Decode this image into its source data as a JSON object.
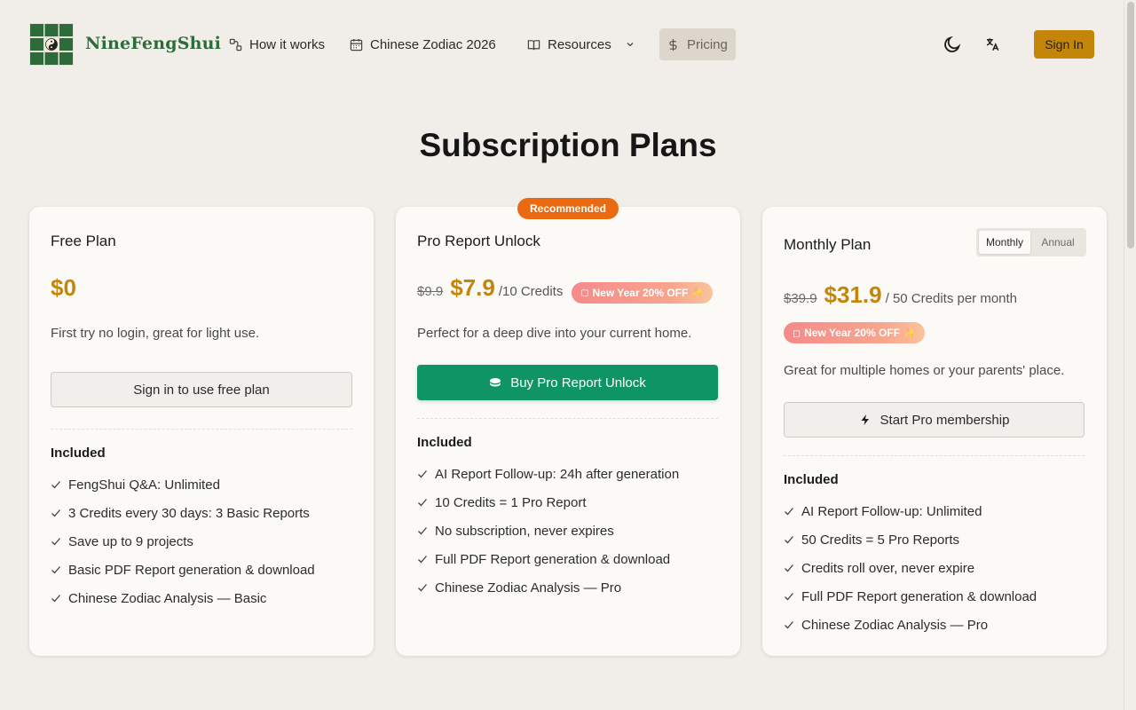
{
  "header": {
    "brand": "NineFengShui",
    "nav": [
      {
        "label": "How it works",
        "icon": "route-icon"
      },
      {
        "label": "Chinese Zodiac 2026",
        "icon": "calendar-icon"
      },
      {
        "label": "Resources",
        "icon": "book-icon"
      },
      {
        "label": "Pricing",
        "icon": "dollar-icon"
      }
    ],
    "signin_label": "Sign In"
  },
  "page_title": "Subscription Plans",
  "colors": {
    "accent": "#c4860a",
    "green": "#0f9565",
    "recommended": "#ea6a11",
    "background": "#f1eeea"
  },
  "plans": {
    "free": {
      "title": "Free Plan",
      "price": "$0",
      "description": "First try no login, great for light use.",
      "button": "Sign in to use free plan",
      "included_label": "Included",
      "features": [
        "FengShui Q&A: Unlimited",
        "3 Credits every 30 days: 3 Basic Reports",
        "Save up to 9 projects",
        "Basic PDF Report generation & download",
        "Chinese Zodiac Analysis — Basic"
      ]
    },
    "pro": {
      "badge": "Recommended",
      "title": "Pro Report Unlock",
      "old_price": "$9.9",
      "price": "$7.9",
      "unit": "/10 Credits",
      "promo": "New Year 20% OFF",
      "description": "Perfect for a deep dive into your current home.",
      "button": "Buy Pro Report Unlock",
      "included_label": "Included",
      "features": [
        "AI Report Follow-up: 24h after generation",
        "10 Credits = 1 Pro Report",
        "No subscription, never expires",
        "Full PDF Report generation & download",
        "Chinese Zodiac Analysis — Pro"
      ]
    },
    "monthly": {
      "title": "Monthly Plan",
      "toggle": [
        "Monthly",
        "Annual"
      ],
      "old_price": "$39.9",
      "price": "$31.9",
      "unit": "/ 50 Credits per month",
      "promo": "New Year 20% OFF",
      "description": "Great for multiple homes or your parents' place.",
      "button": "Start Pro membership",
      "included_label": "Included",
      "features": [
        "AI Report Follow-up: Unlimited",
        "50 Credits = 5 Pro Reports",
        "Credits roll over, never expire",
        "Full PDF Report generation & download",
        "Chinese Zodiac Analysis — Pro"
      ]
    }
  }
}
